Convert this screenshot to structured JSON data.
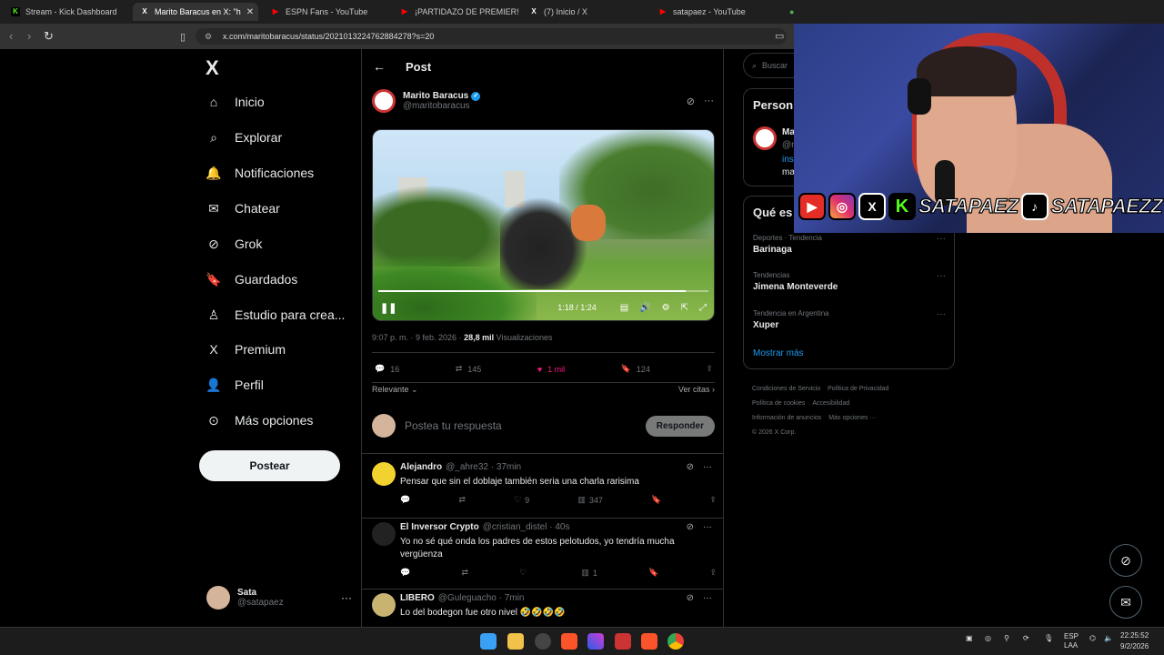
{
  "browser": {
    "tabs": [
      {
        "label": "Stream - Kick Dashboard",
        "fav_color": "#53fc18",
        "fav_char": "K"
      },
      {
        "label": "Marito Baracus en X: \"h",
        "fav_color": "#ffffff",
        "fav_char": "X",
        "active": true
      },
      {
        "label": "ESPN Fans - YouTube",
        "fav_color": "#ff0000",
        "fav_char": "▶"
      },
      {
        "label": "¡PARTIDAZO DE PREMIER! CON",
        "fav_color": "#ff0000",
        "fav_char": "▶"
      },
      {
        "label": "(7) Inicio / X",
        "fav_color": "#ffffff",
        "fav_char": "X"
      },
      {
        "label": "satapaez - YouTube",
        "fav_color": "#ff0000",
        "fav_char": "▶"
      }
    ],
    "url": "x.com/maritobaracus/status/2021013224762884278?s=20"
  },
  "nav": {
    "logo": "X",
    "items": [
      {
        "label": "Inicio",
        "icon": "home-icon",
        "glyph": "⌂"
      },
      {
        "label": "Explorar",
        "icon": "search-icon",
        "glyph": "⌕"
      },
      {
        "label": "Notificaciones",
        "icon": "bell-icon",
        "glyph": "🔔"
      },
      {
        "label": "Chatear",
        "icon": "mail-icon",
        "glyph": "✉"
      },
      {
        "label": "Grok",
        "icon": "grok-icon",
        "glyph": "⊘"
      },
      {
        "label": "Guardados",
        "icon": "bookmark-icon",
        "glyph": "🔖"
      },
      {
        "label": "Estudio para crea...",
        "icon": "studio-icon",
        "glyph": "♙"
      },
      {
        "label": "Premium",
        "icon": "x-premium-icon",
        "glyph": "X"
      },
      {
        "label": "Perfil",
        "icon": "person-icon",
        "glyph": "👤"
      },
      {
        "label": "Más opciones",
        "icon": "more-circle-icon",
        "glyph": "⊙"
      }
    ],
    "post_button": "Postear",
    "me": {
      "name": "Sata",
      "handle": "@satapaez"
    }
  },
  "post": {
    "header": "Post",
    "author_name": "Marito Baracus",
    "author_handle": "@maritobaracus",
    "video_time": "1:18 / 1:24",
    "video_progress": 0.93,
    "time": "9:07 p. m. · 9 feb. 2026 · ",
    "views_count": "28,8 mil",
    "views_label": "Visualizaciones",
    "replies": "16",
    "reposts": "145",
    "likes": "1 mil",
    "bookmarks": "124",
    "sort_label": "Relevante",
    "quotes_label": "Ver citas",
    "reply_placeholder": "Postea tu respuesta",
    "reply_button": "Responder"
  },
  "replies": [
    {
      "name": "Alejandro",
      "handle": "@_ahre32 · 37min",
      "text": "Pensar que sin el doblaje también seria una charla rarisima",
      "likes": "9",
      "views": "347",
      "avatar_color": "#f2d22e"
    },
    {
      "name": "El Inversor Crypto",
      "handle": "@cristian_distel · 40s",
      "text": "Yo no sé qué onda los padres de estos pelotudos, yo tendría mucha vergüenza",
      "likes": "",
      "views": "1",
      "avatar_color": "#222222"
    },
    {
      "name": "LIBERO",
      "handle": "@Guleguacho · 7min",
      "text": "Lo del bodegon fue otro nivel 🤣🤣🤣🤣",
      "likes": "",
      "views": "",
      "avatar_color": "#c9b370"
    }
  ],
  "right": {
    "search_placeholder": "Buscar",
    "people_title": "Person",
    "people_name": "Ma",
    "people_handle": "@m",
    "people_bio1": "ins",
    "people_bio2": "ma",
    "trends_title": "Qué es",
    "trends": [
      {
        "cat": "Deportes · Tendencia",
        "name": "Barinaga"
      },
      {
        "cat": "Tendencias",
        "name": "Jimena Monteverde"
      },
      {
        "cat": "Tendencia en Argentina",
        "name": "Xuper"
      }
    ],
    "show_more": "Mostrar más",
    "footer": [
      "Condiciones de Servicio",
      "Política de Privacidad",
      "Política de cookies",
      "Accesibilidad",
      "Información de anuncios",
      "Más opciones ···",
      "© 2026 X Corp."
    ]
  },
  "overlay": {
    "handle1": "SATAPAEZ",
    "handle2": "SATAPAEZZ",
    "icons": [
      "youtube-icon",
      "instagram-icon",
      "x-icon",
      "kick-icon",
      "tiktok-icon"
    ]
  },
  "taskbar": {
    "lang": "ESP",
    "lang2": "LAA",
    "time": "22:25:52",
    "date": "9/2/2026"
  },
  "colors": {
    "accent": "#1d9bf0",
    "like": "#f91880",
    "kick": "#53fc18"
  }
}
